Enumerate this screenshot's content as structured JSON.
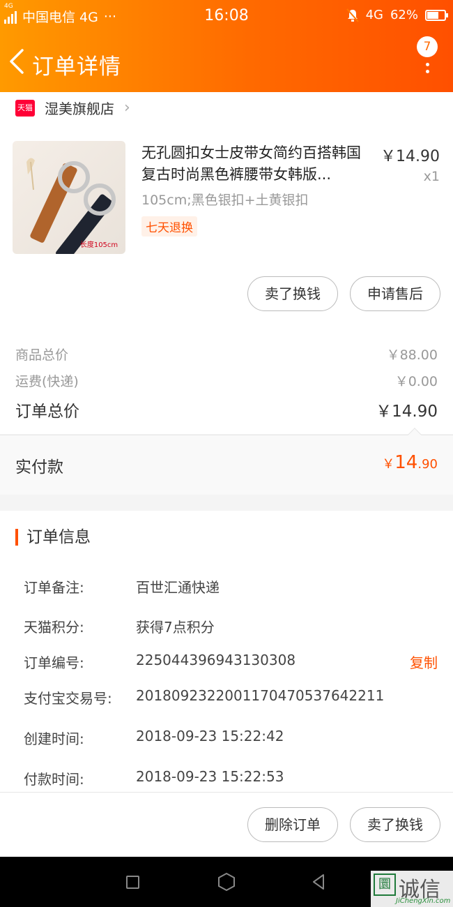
{
  "status_bar": {
    "network_label": "4G",
    "carrier": "中国电信 4G",
    "dots": "···",
    "time": "16:08",
    "network": "4G",
    "battery": "62%"
  },
  "nav": {
    "title": "订单详情",
    "badge": "7"
  },
  "store": {
    "icon_text": "天猫",
    "name": "湿美旗舰店"
  },
  "product": {
    "title": "无孔圆扣女士皮带女简约百搭韩国复古时尚黑色裤腰带女韩版...",
    "price": "￥14.90",
    "qty": "x1",
    "sku": "105cm;黑色银扣+土黄银扣",
    "tag": "七天退换",
    "image_label": "长度105cm"
  },
  "item_actions": {
    "sell_label": "卖了换钱",
    "after_sale_label": "申请售后"
  },
  "price_summary": {
    "goods_label": "商品总价",
    "goods_value": "￥88.00",
    "shipping_label": "运费(快递)",
    "shipping_value": "￥0.00",
    "total_label": "订单总价",
    "total_value": "￥14.90"
  },
  "paid": {
    "label": "实付款",
    "currency": "￥",
    "int": "14",
    "dec": ".90"
  },
  "order_info": {
    "title": "订单信息",
    "rows": [
      {
        "key": "订单备注:",
        "value": "百世汇通快递"
      },
      {
        "key": "天猫积分:",
        "value": "获得7点积分"
      },
      {
        "key": "订单编号:",
        "value": "225044396943130308",
        "action": "复制"
      },
      {
        "key": "支付宝交易号:",
        "value": "2018092322001170470537642211"
      },
      {
        "key": "创建时间:",
        "value": "2018-09-23 15:22:42"
      },
      {
        "key": "付款时间:",
        "value": "2018-09-23 15:22:53"
      }
    ]
  },
  "bottom_actions": {
    "delete_label": "删除订单",
    "sell_label": "卖了换钱"
  },
  "watermark": {
    "logo": "圜",
    "text": "诚信",
    "sub": "JiChengXin.com"
  },
  "colors": {
    "accent": "#ff5000",
    "header_start": "#ff9a00",
    "header_end": "#ff5000",
    "tmall": "#ff0036"
  }
}
